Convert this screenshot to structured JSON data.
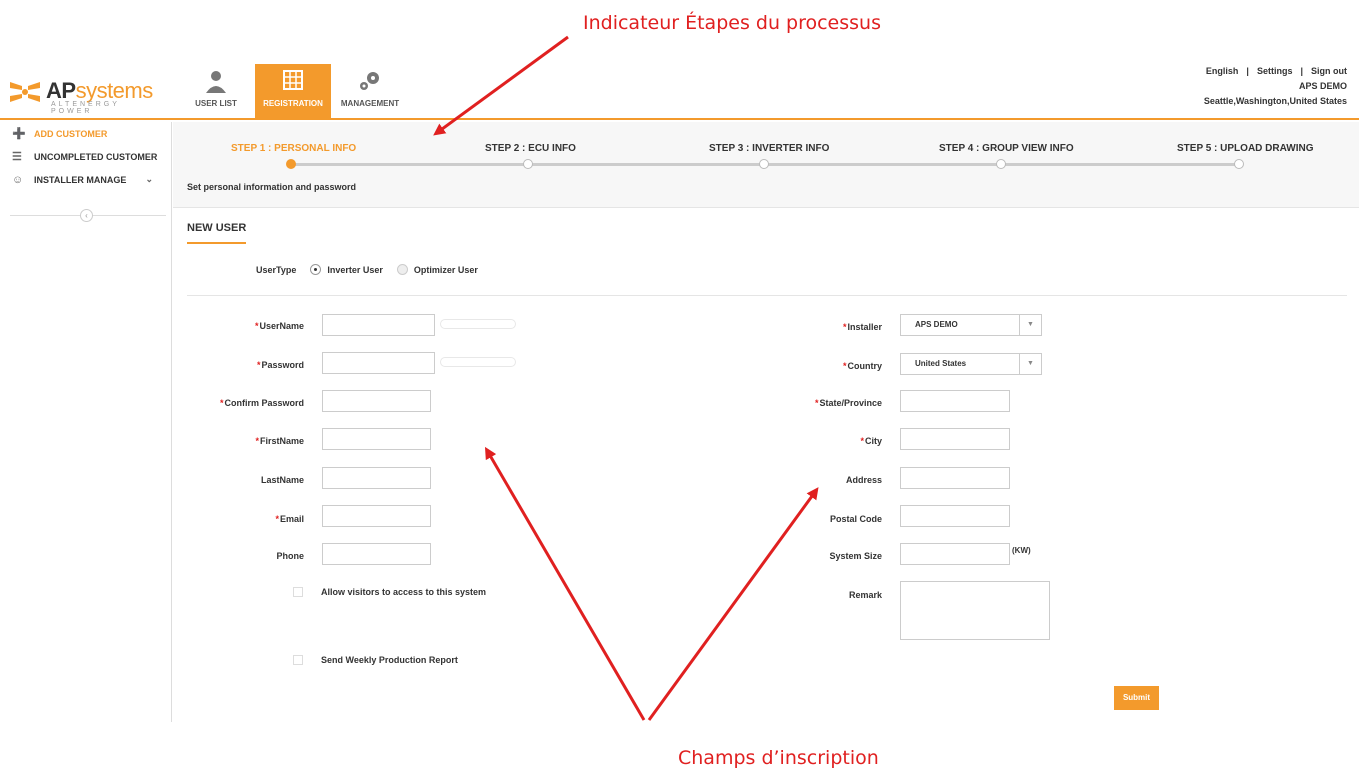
{
  "annotations": {
    "top": "Indicateur Étapes du processus",
    "bottom": "Champs d’inscription"
  },
  "brand": {
    "name_prefix": "AP",
    "name_suffix": "systems",
    "tagline": "ALTENERGY POWER"
  },
  "topnav": [
    {
      "label": "USER LIST",
      "icon": "user-icon"
    },
    {
      "label": "REGISTRATION",
      "icon": "grid-icon",
      "active": true
    },
    {
      "label": "MANAGEMENT",
      "icon": "gears-icon"
    }
  ],
  "account": {
    "language": "English",
    "settings": "Settings",
    "signout": "Sign out",
    "user": "APS DEMO",
    "location": "Seattle,Washington,United States"
  },
  "sidebar": {
    "items": [
      {
        "label": "ADD CUSTOMER",
        "icon": "add-user-icon",
        "active": true
      },
      {
        "label": "UNCOMPLETED CUSTOMER",
        "icon": "list-icon"
      },
      {
        "label": "INSTALLER MANAGE",
        "icon": "users-icon"
      }
    ]
  },
  "steps": {
    "items": [
      {
        "label": "STEP 1 : PERSONAL INFO",
        "active": true
      },
      {
        "label": "STEP 2 : ECU INFO"
      },
      {
        "label": "STEP 3 : INVERTER INFO"
      },
      {
        "label": "STEP 4 : GROUP VIEW INFO"
      },
      {
        "label": "STEP 5 : UPLOAD DRAWING"
      }
    ],
    "description": "Set personal information and password"
  },
  "form": {
    "title": "NEW USER",
    "usertype_label": "UserType",
    "usertype_options": [
      "Inverter User",
      "Optimizer User"
    ],
    "left": {
      "username": "UserName",
      "password": "Password",
      "confirm": "Confirm Password",
      "firstname": "FirstName",
      "lastname": "LastName",
      "email": "Email",
      "phone": "Phone"
    },
    "right": {
      "installer": "Installer",
      "installer_value": "APS DEMO",
      "country": "Country",
      "country_value": "United States",
      "state": "State/Province",
      "city": "City",
      "address": "Address",
      "postal": "Postal Code",
      "system_size": "System Size",
      "unit": "(KW)",
      "remark": "Remark"
    },
    "allow_visitors": "Allow visitors to access to this system",
    "weekly_report": "Send Weekly Production Report",
    "submit": "Submit"
  },
  "colors": {
    "accent": "#f39a2c",
    "annotation": "#e02020"
  }
}
